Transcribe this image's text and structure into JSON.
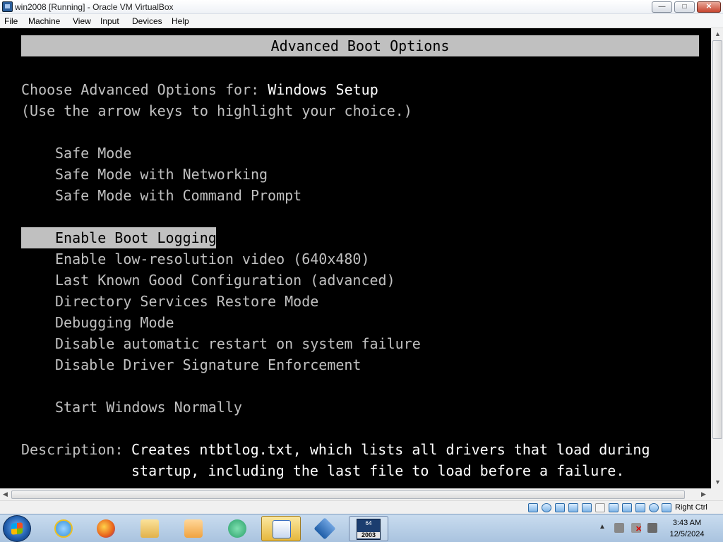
{
  "window": {
    "title": "win2008 [Running] - Oracle VM VirtualBox",
    "min_glyph": "—",
    "max_glyph": "□",
    "close_glyph": "✕"
  },
  "menu": [
    "File",
    "Machine",
    "View",
    "Input",
    "Devices",
    "Help"
  ],
  "boot": {
    "header": "Advanced Boot Options",
    "choose_prefix": "Choose Advanced Options for: ",
    "choose_target": "Windows Setup",
    "hint": "(Use the arrow keys to highlight your choice.)",
    "group1": [
      "Safe Mode",
      "Safe Mode with Networking",
      "Safe Mode with Command Prompt"
    ],
    "selected": "Enable Boot Logging",
    "group2": [
      "Enable low-resolution video (640x480)",
      "Last Known Good Configuration (advanced)",
      "Directory Services Restore Mode",
      "Debugging Mode",
      "Disable automatic restart on system failure",
      "Disable Driver Signature Enforcement"
    ],
    "normal": "Start Windows Normally",
    "description_label": "Description: ",
    "description_line1": "Creates ntbtlog.txt, which lists all drivers that load during",
    "description_line2": "startup, including the last file to load before a failure."
  },
  "statusbar": {
    "host_key": "Right Ctrl",
    "icons": [
      "hard-disk-icon",
      "optical-drive-icon",
      "audio-icon",
      "network-icon",
      "usb-icon",
      "shared-folders-icon",
      "display-icon",
      "video-capture-icon",
      "virtualization-icon",
      "mouse-integration-icon",
      "keyboard-icon"
    ]
  },
  "taskbar": {
    "apps": [
      {
        "name": "ie-icon",
        "color": "#2f8fdc"
      },
      {
        "name": "firefox-icon",
        "color": "#e8621b"
      },
      {
        "name": "explorer-icon",
        "color": "#f1c75a"
      },
      {
        "name": "media-player-icon",
        "color": "#f0a340"
      },
      {
        "name": "green-app-icon",
        "color": "#2aa06a"
      },
      {
        "name": "task-app-icon",
        "color": "#3b6ec0"
      },
      {
        "name": "virtualbox-icon",
        "color": "#1f5ea8"
      },
      {
        "name": "server-2003-icon",
        "color": "#1b3d6f",
        "label_top": "64",
        "label_bottom": "2003"
      }
    ],
    "show_hidden": "▲",
    "time": "3:43 AM",
    "date": "12/5/2024"
  }
}
